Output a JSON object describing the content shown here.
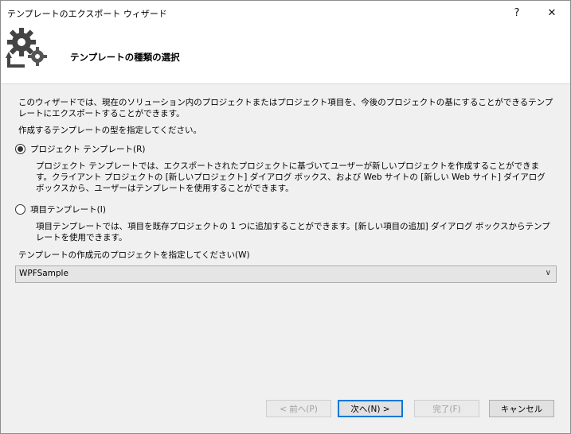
{
  "window": {
    "title": "テンプレートのエクスポート ウィザード",
    "help_label": "?",
    "close_label": "✕"
  },
  "header": {
    "title": "テンプレートの種類の選択",
    "icon": "gear-export-icon"
  },
  "content": {
    "intro": "このウィザードでは、現在のソリューション内のプロジェクトまたはプロジェクト項目を、今後のプロジェクトの基にすることができるテンプレートにエクスポートすることができます。",
    "instruction": "作成するテンプレートの型を指定してください。",
    "options": [
      {
        "label": "プロジェクト テンプレート(R)",
        "checked": true,
        "description": "プロジェクト テンプレートでは、エクスポートされたプロジェクトに基づいてユーザーが新しいプロジェクトを作成することができます。クライアント プロジェクトの [新しいプロジェクト] ダイアログ ボックス、および Web サイトの [新しい Web サイト] ダイアログ ボックスから、ユーザーはテンプレートを使用することができます。"
      },
      {
        "label": "項目テンプレート(I)",
        "checked": false,
        "description": "項目テンプレートでは、項目を既存プロジェクトの 1 つに追加することができます。[新しい項目の追加] ダイアログ ボックスからテンプレートを使用できます。"
      }
    ],
    "project_label": "テンプレートの作成元のプロジェクトを指定してください(W)",
    "project_value": "WPFSample"
  },
  "footer": {
    "back_label": "< 前へ(P)",
    "next_label": "次へ(N) >",
    "finish_label": "完了(F)",
    "cancel_label": "キャンセル"
  },
  "colors": {
    "accent": "#0078d7",
    "header_bg": "#ffffff",
    "body_bg": "#f0f0f0"
  }
}
